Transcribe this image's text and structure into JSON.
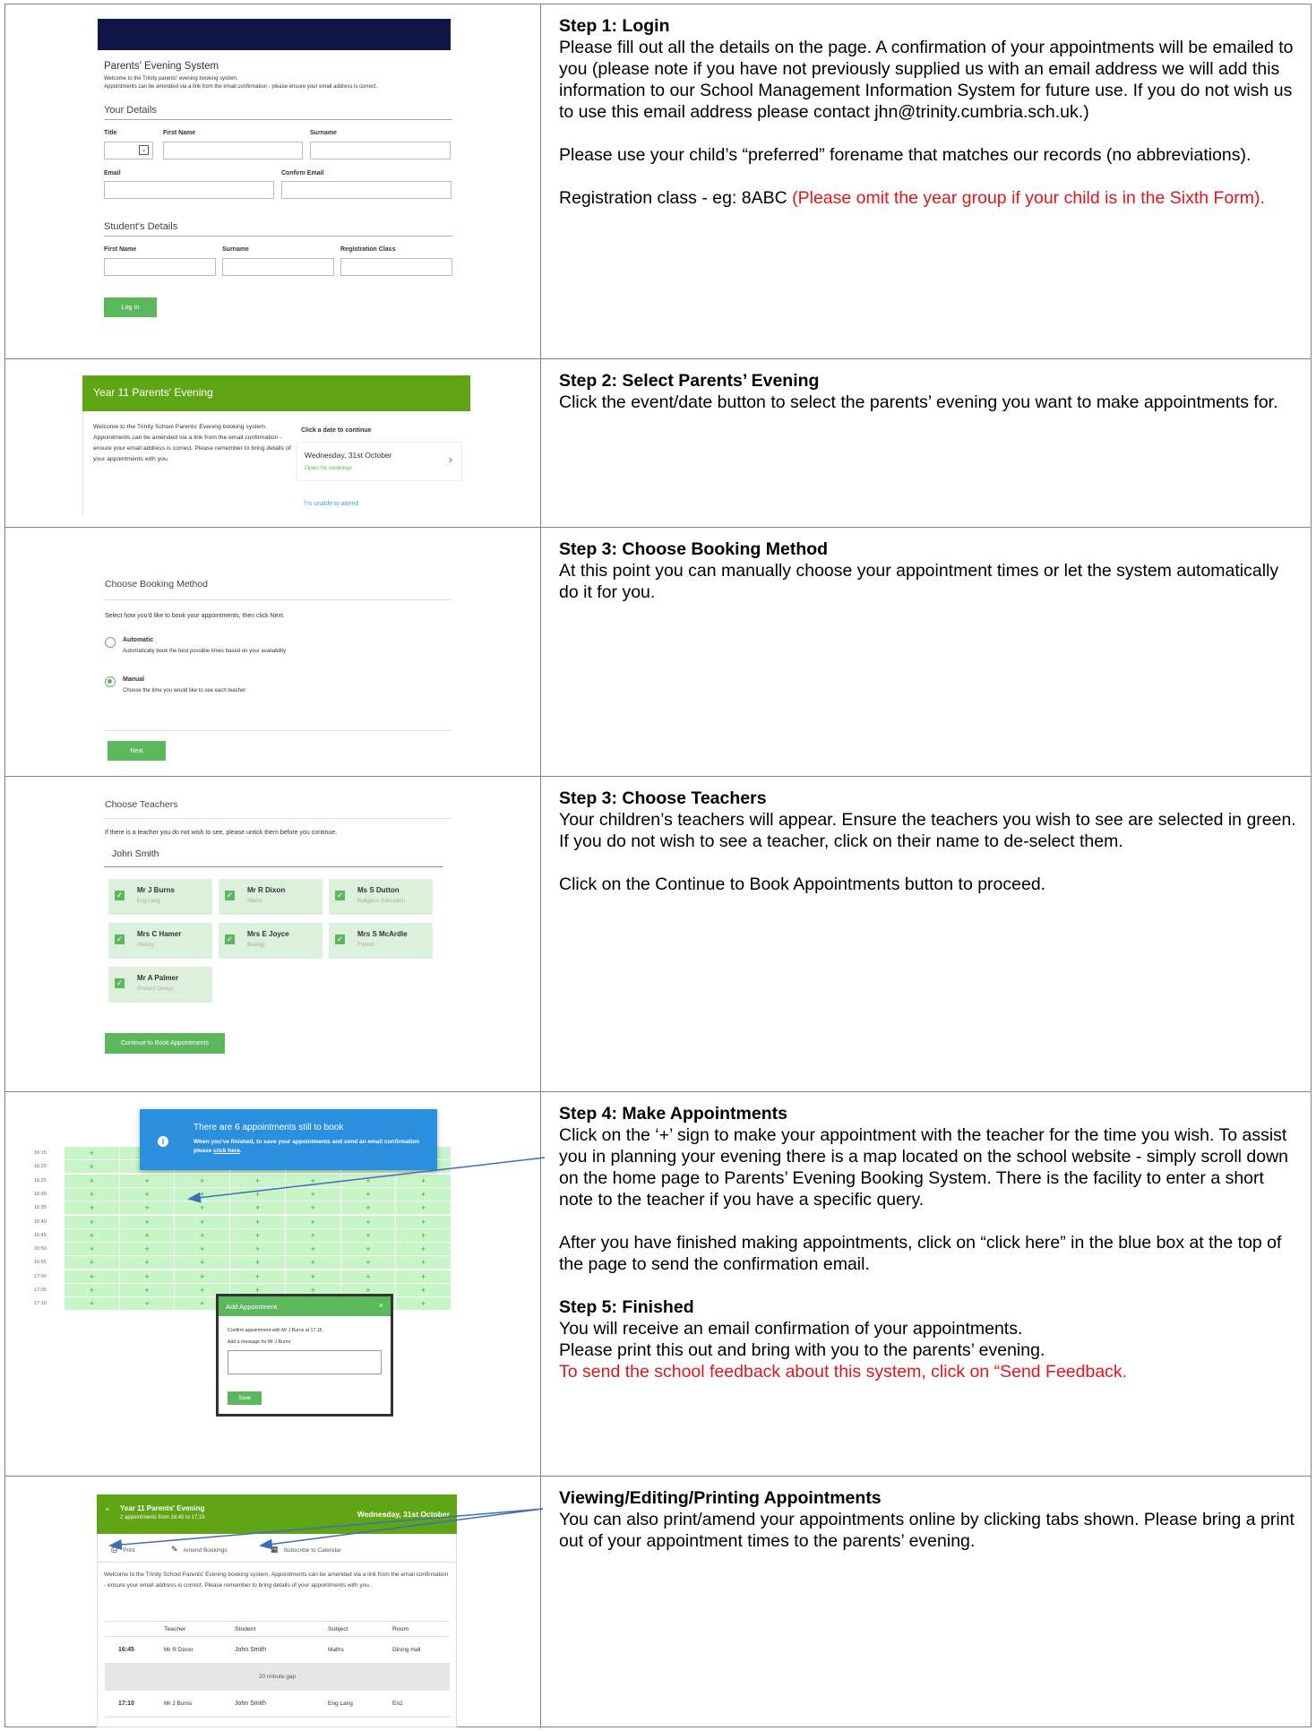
{
  "row1": {
    "heading": "Step 1: Login",
    "p1": "Please fill out all the details on the page. A confirmation of your appointments will be emailed to you (please note if you have not previously supplied us with an email address we will add this information to our School Management Information System for future use.  If you do not wish us to use this email address please contact jhn@trinity.cumbria.sch.uk.)",
    "p2": "Please use your child’s “preferred” forename that matches our records (no abbreviations).",
    "p3_black": "Registration class - eg: 8ABC ",
    "p3_red": "(Please omit the year group if your child is in the Sixth Form).",
    "screen": {
      "title": "Parents' Evening System",
      "welcome1": "Welcome to the Trinity parents' evening booking system.",
      "welcome2": "Appointments can be amended via a link from the email confirmation - please ensure your email address is correct.",
      "your_details": "Your Details",
      "title_label": "Title",
      "first_name": "First Name",
      "surname": "Surname",
      "email": "Email",
      "confirm_email": "Confirm Email",
      "student_details": "Student's Details",
      "s_first_name": "First Name",
      "s_surname": "Surname",
      "reg_class": "Registration Class",
      "login": "Log In"
    }
  },
  "row2": {
    "heading": "Step 2: Select Parents’ Evening",
    "p1": "Click the event/date button to select the parents’ evening you want to make appointments for.",
    "screen": {
      "banner": "Year 11 Parents' Evening",
      "welcome": "Welcome to the Trinity School Parents' Evening booking system. Appointments can be amended via a link from the email confirmation - ensure your email address is correct. Please remember to bring details of your appointments with you.",
      "click_date": "Click a date to continue",
      "date": "Wednesday, 31st October",
      "open": "Open for bookings",
      "unable": "I'm unable to attend"
    }
  },
  "row3": {
    "heading": "Step 3: Choose Booking Method",
    "p1": "At this point you can manually choose your appointment times or let the system automatically do it for you.",
    "screen": {
      "title": "Choose Booking Method",
      "instruction": "Select how you'd like to book your appointments, then click Next.",
      "auto": "Automatic",
      "auto_desc": "Automatically book the best possible times based on your availability",
      "manual": "Manual",
      "manual_desc": "Choose the time you would like to see each teacher",
      "next": "Next"
    }
  },
  "row4": {
    "heading": "Step 3: Choose Teachers",
    "p1": "Your children’s teachers will appear. Ensure the teachers you wish to see are selected in green. If you do not wish to see a teacher, click on their name to de-select them.",
    "p2": "Click on the Continue to Book Appointments button to proceed.",
    "screen": {
      "title": "Choose Teachers",
      "instruction": "If there is a teacher you do not wish to see, please untick them before you continue.",
      "student": "John Smith",
      "teachers": [
        {
          "name": "Mr J Burns",
          "subject": "Eng Lang"
        },
        {
          "name": "Mr R Dixon",
          "subject": "Maths"
        },
        {
          "name": "Ms S Dutton",
          "subject": "Religious Education"
        },
        {
          "name": "Mrs C Hamer",
          "subject": "History"
        },
        {
          "name": "Mrs E Joyce",
          "subject": "Biology"
        },
        {
          "name": "Mrs S McArdle",
          "subject": "French"
        },
        {
          "name": "Mr A Palmer",
          "subject": "Product Design"
        }
      ],
      "continue": "Continue to Book Appointments"
    }
  },
  "row5": {
    "heading": "Step 4: Make Appointments",
    "p1": "Click on the ‘+’ sign to make your appointment with the teacher for the time you wish. To assist you in planning your evening there is a map located on the school website - simply scroll down on the home page to Parents’ Evening Booking System.  There is the facility to enter a short note to the teacher if you have a specific query.",
    "p2": "After you have finished making appointments, click on “click here” in the blue box at the top of the page to send the confirmation email.",
    "heading2": "Step 5: Finished",
    "p3": "You will receive an email confirmation of your appointments.",
    "p4": "Please print this out and bring with you to the parents’ evening.",
    "p5_red": "To send the school feedback about this system, click on “Send Feedback.",
    "screen": {
      "notice_title": "There are 6 appointments still to book",
      "notice_body": "When you've finished, to save your appointments and send an email confirmation please ",
      "notice_link": "click here",
      "times": [
        "16:15",
        "16:20",
        "16:25",
        "16:30",
        "16:35",
        "16:40",
        "16:45",
        "16:50",
        "16:55",
        "17:00",
        "17:05",
        "17:10"
      ],
      "plus": "+",
      "dialog_title": "Add Appointment",
      "dialog_close": "×",
      "dialog_confirm": "Confirm appointment with Mr J Burns at 17:15.",
      "dialog_msg": "Add a message for Mr J Burns:",
      "dialog_save": "Save"
    }
  },
  "row6": {
    "heading": "Viewing/Editing/Printing Appointments",
    "p1": "You can also print/amend your appointments online by clicking tabs shown. Please bring a print out of your appointment times to the parents’ evening.",
    "screen": {
      "banner": "Year 11 Parents' Evening",
      "banner_sub": "2 appointments from 16:45 to 17:15",
      "banner_date": "Wednesday, 31st October",
      "print": "Print",
      "amend": "Amend Bookings",
      "subscribe": "Subscribe to Calendar",
      "welcome": "Welcome to the Trinity School Parents' Evening booking system. Appointments can be amended via a link from the email confirmation - ensure your email address is correct. Please remember to bring details of your appointments with you.",
      "headers": [
        "Teacher",
        "Student",
        "Subject",
        "Room"
      ],
      "appointments": [
        {
          "time": "16:45",
          "teacher": "Mr R Dixon",
          "student": "John Smith",
          "subject": "Maths",
          "room": "Dining Hall"
        },
        {
          "time": "17:10",
          "teacher": "Mr J Burns",
          "student": "John Smith",
          "subject": "Eng Lang",
          "room": "En2"
        }
      ],
      "gap": "20 minute gap"
    }
  }
}
